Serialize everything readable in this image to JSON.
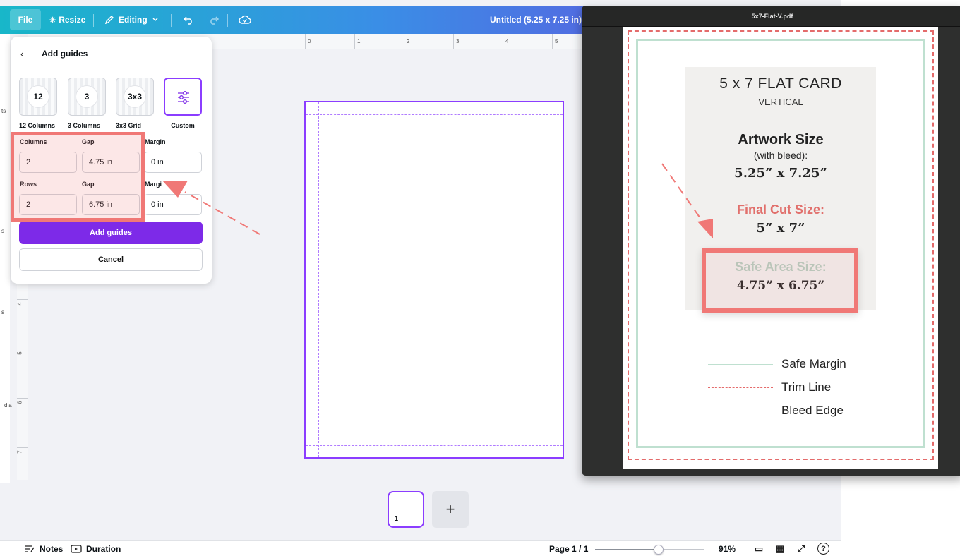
{
  "topbar": {
    "file": "File",
    "resize": "Resize",
    "editing": "Editing",
    "doc_title": "Untitled (5.25 x 7.25 in)"
  },
  "left_strip": [
    "ts",
    "s",
    "s",
    "dia"
  ],
  "ruler": {
    "h": [
      "0",
      "1",
      "2",
      "3",
      "4",
      "5"
    ],
    "v": [
      "4",
      "5",
      "6",
      "7"
    ]
  },
  "guides_panel": {
    "title": "Add guides",
    "presets": [
      {
        "badge": "12",
        "label": "12 Columns"
      },
      {
        "badge": "3",
        "label": "3 Columns"
      },
      {
        "badge": "3x3",
        "label": "3x3 Grid"
      },
      {
        "badge": "",
        "label": "Custom"
      }
    ],
    "columns_label": "Columns",
    "columns_value": "2",
    "columns_gap_label": "Gap",
    "columns_gap_value": "4.75 in",
    "columns_margin_label": "Margin",
    "columns_margin_value": "0 in",
    "rows_label": "Rows",
    "rows_value": "2",
    "rows_gap_label": "Gap",
    "rows_gap_value": "6.75 in",
    "rows_margin_label": "Margi",
    "rows_margin_value": "0 in",
    "add_button": "Add guides",
    "cancel_button": "Cancel"
  },
  "pages": {
    "thumb_number": "1",
    "add_symbol": "+"
  },
  "bottombar": {
    "notes": "Notes",
    "duration": "Duration",
    "page_indicator": "Page 1 / 1",
    "zoom_fraction": 0.58,
    "zoom_value": "91%"
  },
  "pdf": {
    "filename": "5x7-Flat-V.pdf",
    "heading": "5 x 7 FLAT CARD",
    "subheading": "VERTICAL",
    "artwork_label": "Artwork Size",
    "artwork_bleed": "(with bleed):",
    "artwork_value": "5.25” x 7.25”",
    "cut_label": "Final Cut Size:",
    "cut_value": "5” x 7”",
    "safe_label": "Safe Area Size:",
    "safe_value": "4.75” x 6.75”",
    "legend": [
      "Safe Margin",
      "Trim Line",
      "Bleed Edge"
    ]
  },
  "colors": {
    "accent": "#8b3dff",
    "button": "#7d2ae8",
    "highlight": "#f07876",
    "trim": "#e46b6b",
    "safe": "#bfe0d0"
  }
}
